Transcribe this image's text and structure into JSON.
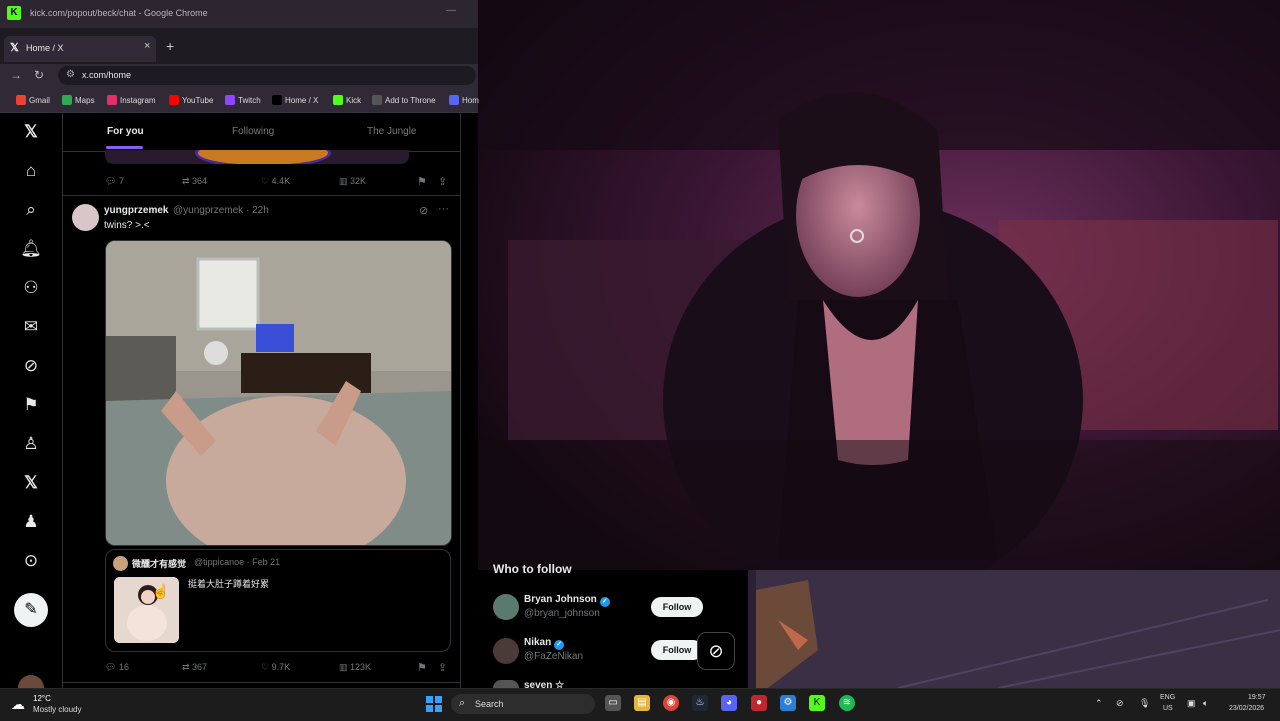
{
  "browser": {
    "window_title": "kick.com/popout/beck/chat - Google Chrome",
    "tab_title": "Home / X",
    "url": "x.com/home",
    "bookmarks": [
      {
        "label": "Gmail",
        "icon": "gmail-icon",
        "color": "#ea4335"
      },
      {
        "label": "Maps",
        "icon": "maps-icon",
        "color": "#34a853"
      },
      {
        "label": "Instagram",
        "icon": "instagram-icon",
        "color": "#e1306c"
      },
      {
        "label": "YouTube",
        "icon": "youtube-icon",
        "color": "#ff0000"
      },
      {
        "label": "Twitch",
        "icon": "twitch-icon",
        "color": "#9146ff"
      },
      {
        "label": "Home / X",
        "icon": "x-icon",
        "color": "#000000"
      },
      {
        "label": "Kick",
        "icon": "kick-icon",
        "color": "#53fc18"
      },
      {
        "label": "Add to Throne",
        "icon": "throne-icon",
        "color": "#555555"
      },
      {
        "label": "Hom",
        "icon": "home-icon",
        "color": "#5865f2"
      }
    ]
  },
  "x": {
    "tabs": [
      {
        "label": "For you",
        "active": true
      },
      {
        "label": "Following",
        "active": false
      },
      {
        "label": "The Jungle",
        "active": false
      }
    ],
    "prev_post_stats": {
      "replies": "7",
      "reposts": "364",
      "likes": "4.4K",
      "views": "32K"
    },
    "post": {
      "name": "yungprzemek",
      "handle": "@yungprzemek · 22h",
      "text": "twins? >.<",
      "quote": {
        "name": "微醺才有感觉",
        "handle": "@tippicanoe · Feb 21",
        "text": "挺着大肚子蹲着好累"
      },
      "stats": {
        "replies": "16",
        "reposts": "367",
        "likes": "9.7K",
        "views": "123K"
      }
    },
    "who_to_follow": {
      "title": "Who to follow",
      "follow_label": "Follow",
      "users": [
        {
          "name": "Bryan Johnson",
          "handle": "@bryan_johnson"
        },
        {
          "name": "Nikan",
          "handle": "@FaZeNikan"
        },
        {
          "name": "seven ☆",
          "handle": ""
        }
      ]
    }
  },
  "taskbar": {
    "weather_temp": "12°C",
    "weather_desc": "Mostly cloudy",
    "search_label": "Search",
    "lang_top": "ENG",
    "lang_bottom": "US",
    "time": "19:57",
    "date": "23/02/2026"
  }
}
